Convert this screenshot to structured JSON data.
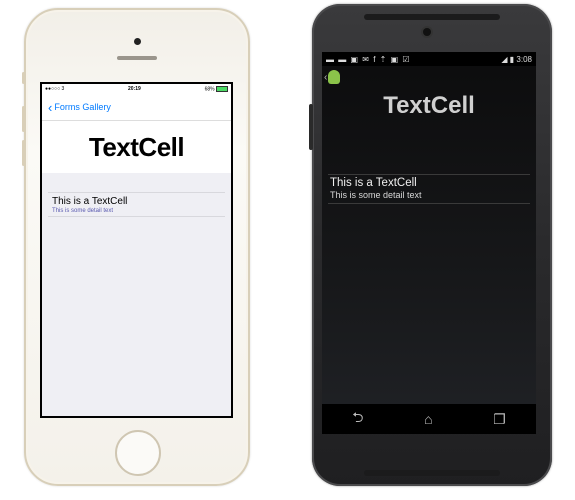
{
  "ios": {
    "status": {
      "carrier": "●●○○○ 3 ",
      "time": "20:19",
      "battery": "68%"
    },
    "nav": {
      "back_label": "Forms Gallery"
    },
    "page_title": "TextCell",
    "cell": {
      "text": "This is a TextCell",
      "detail": "This is some detail text"
    }
  },
  "android": {
    "status": {
      "time": "3:08"
    },
    "page_title": "TextCell",
    "cell": {
      "text": "This is a TextCell",
      "detail": "This is some detail text"
    },
    "navbar": {
      "back_icon": "back-arrow-icon",
      "home_icon": "home-icon",
      "recents_icon": "recents-icon"
    }
  },
  "colors": {
    "ios_tint": "#007aff",
    "ios_detail": "#5a5ab0",
    "android_logo": "#8bc34a"
  }
}
